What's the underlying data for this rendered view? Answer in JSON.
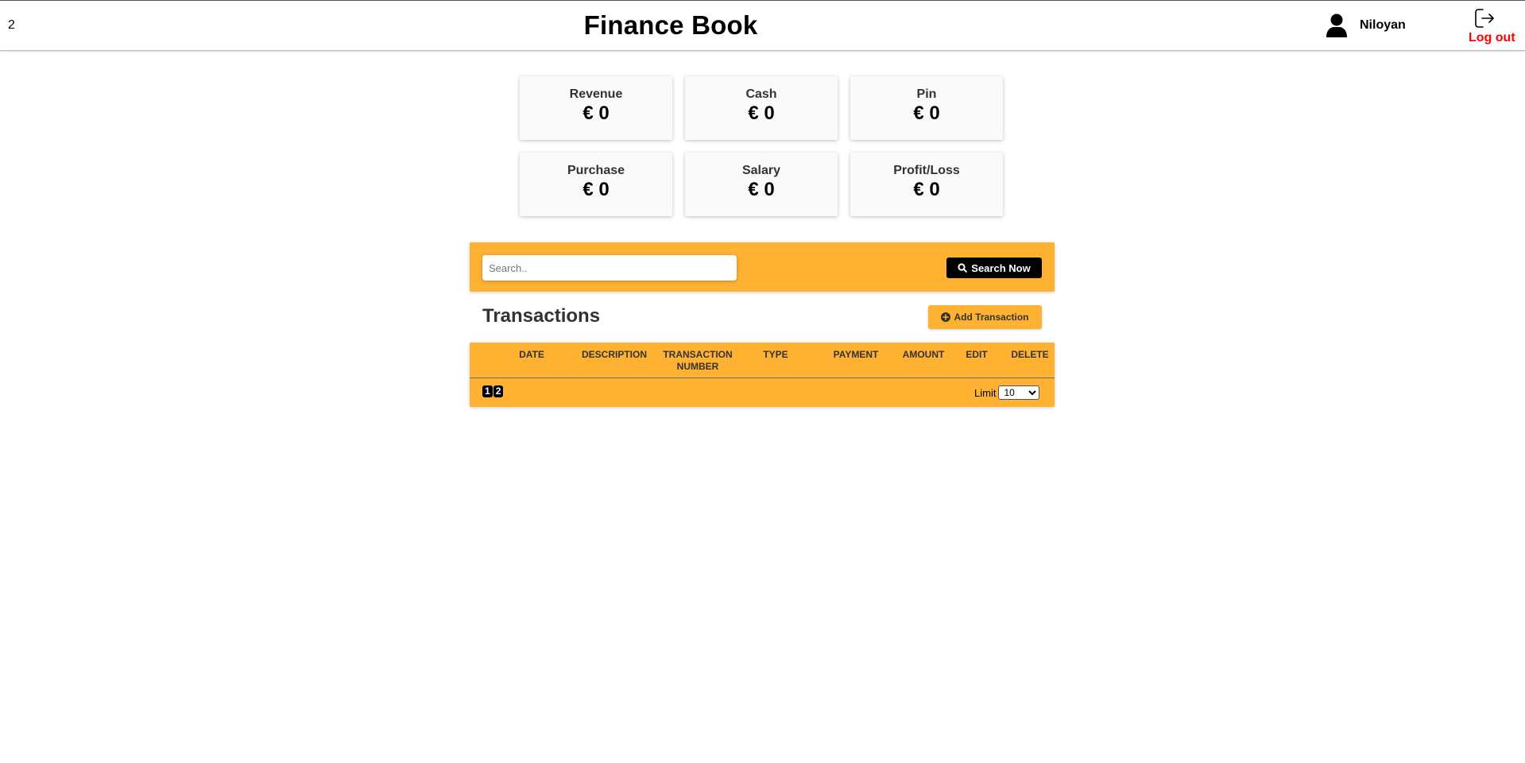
{
  "header": {
    "page_counter": "2",
    "title": "Finance Book",
    "username": "Niloyan",
    "logout_label": "Log out"
  },
  "summary_cards": [
    {
      "label": "Revenue",
      "value": "€ 0"
    },
    {
      "label": "Cash",
      "value": "€ 0"
    },
    {
      "label": "Pin",
      "value": "€ 0"
    },
    {
      "label": "Purchase",
      "value": "€ 0"
    },
    {
      "label": "Salary",
      "value": "€ 0"
    },
    {
      "label": "Profit/Loss",
      "value": "€ 0"
    }
  ],
  "search": {
    "placeholder": "Search..",
    "value": "",
    "button_label": "Search Now"
  },
  "transactions": {
    "title": "Transactions",
    "add_button_label": "Add Transaction",
    "columns": {
      "date": "DATE",
      "description": "DESCRIPTION",
      "transaction_number_1": "TRANSACTION",
      "transaction_number_2": "NUMBER",
      "type": "TYPE",
      "payment": "PAYMENT",
      "amount": "AMOUNT",
      "edit": "EDIT",
      "delete": "DELETE"
    },
    "rows": [],
    "pages": [
      "1",
      "2"
    ],
    "limit_label": "Limit",
    "limit_value": "10"
  },
  "colors": {
    "accent": "#ffb132",
    "logout": "#ff0000",
    "button_dark": "#000000"
  },
  "icons": {
    "user": "user-icon",
    "logout": "logout-icon",
    "search": "search-icon",
    "add": "plus-circle-icon"
  }
}
